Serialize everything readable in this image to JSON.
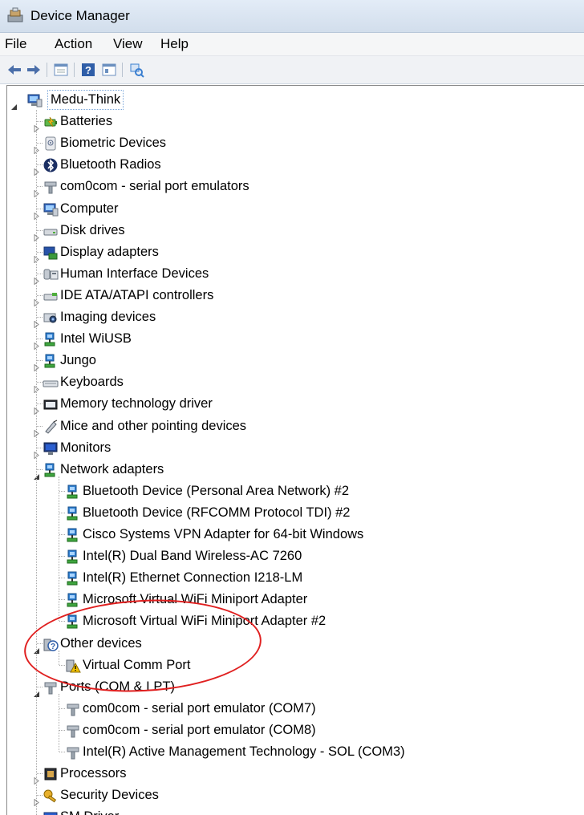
{
  "window": {
    "title": "Device Manager"
  },
  "menu": [
    "File",
    "Action",
    "View",
    "Help"
  ],
  "toolbar": [
    {
      "icon": "back-arrow-icon",
      "color": "#4a6ea9"
    },
    {
      "icon": "forward-arrow-icon",
      "color": "#4a6ea9"
    },
    {
      "icon": "properties-icon",
      "color": "#6a8fbf"
    },
    {
      "icon": "help-icon",
      "color": "#2f5ea8"
    },
    {
      "icon": "view-icon",
      "color": "#6a8fbf"
    },
    {
      "icon": "scan-hardware-icon",
      "color": "#3a7fd0"
    }
  ],
  "tree": [
    {
      "depth": 0,
      "state": "expanded",
      "icon": "computer-icon",
      "label": "Medu-Think",
      "selected": true
    },
    {
      "depth": 1,
      "state": "collapsed",
      "icon": "battery-icon",
      "label": "Batteries"
    },
    {
      "depth": 1,
      "state": "collapsed",
      "icon": "biometric-icon",
      "label": "Biometric Devices"
    },
    {
      "depth": 1,
      "state": "collapsed",
      "icon": "bluetooth-icon",
      "label": "Bluetooth Radios"
    },
    {
      "depth": 1,
      "state": "collapsed",
      "icon": "port-icon",
      "label": "com0com - serial port emulators"
    },
    {
      "depth": 1,
      "state": "collapsed",
      "icon": "computer-icon",
      "label": "Computer"
    },
    {
      "depth": 1,
      "state": "collapsed",
      "icon": "disk-icon",
      "label": "Disk drives"
    },
    {
      "depth": 1,
      "state": "collapsed",
      "icon": "display-icon",
      "label": "Display adapters"
    },
    {
      "depth": 1,
      "state": "collapsed",
      "icon": "hid-icon",
      "label": "Human Interface Devices"
    },
    {
      "depth": 1,
      "state": "collapsed",
      "icon": "ide-icon",
      "label": "IDE ATA/ATAPI controllers"
    },
    {
      "depth": 1,
      "state": "collapsed",
      "icon": "camera-icon",
      "label": "Imaging devices"
    },
    {
      "depth": 1,
      "state": "collapsed",
      "icon": "network-icon",
      "label": "Intel WiUSB"
    },
    {
      "depth": 1,
      "state": "collapsed",
      "icon": "network-icon",
      "label": "Jungo"
    },
    {
      "depth": 1,
      "state": "collapsed",
      "icon": "keyboard-icon",
      "label": "Keyboards"
    },
    {
      "depth": 1,
      "state": "collapsed",
      "icon": "memory-icon",
      "label": "Memory technology driver"
    },
    {
      "depth": 1,
      "state": "collapsed",
      "icon": "mouse-icon",
      "label": "Mice and other pointing devices"
    },
    {
      "depth": 1,
      "state": "collapsed",
      "icon": "monitor-icon",
      "label": "Monitors"
    },
    {
      "depth": 1,
      "state": "expanded",
      "icon": "network-icon",
      "label": "Network adapters"
    },
    {
      "depth": 2,
      "state": "leaf",
      "icon": "network-icon",
      "label": "Bluetooth Device (Personal Area Network) #2"
    },
    {
      "depth": 2,
      "state": "leaf",
      "icon": "network-icon",
      "label": "Bluetooth Device (RFCOMM Protocol TDI) #2"
    },
    {
      "depth": 2,
      "state": "leaf",
      "icon": "network-icon",
      "label": "Cisco Systems VPN Adapter for 64-bit Windows"
    },
    {
      "depth": 2,
      "state": "leaf",
      "icon": "network-icon",
      "label": "Intel(R) Dual Band Wireless-AC 7260"
    },
    {
      "depth": 2,
      "state": "leaf",
      "icon": "network-icon",
      "label": "Intel(R) Ethernet Connection I218-LM"
    },
    {
      "depth": 2,
      "state": "leaf",
      "icon": "network-icon",
      "label": "Microsoft Virtual WiFi Miniport Adapter"
    },
    {
      "depth": 2,
      "state": "leaf",
      "icon": "network-icon",
      "label": "Microsoft Virtual WiFi Miniport Adapter #2"
    },
    {
      "depth": 1,
      "state": "expanded",
      "icon": "unknown-device-icon",
      "label": "Other devices"
    },
    {
      "depth": 2,
      "state": "leaf",
      "icon": "warning-device-icon",
      "label": "Virtual Comm Port"
    },
    {
      "depth": 1,
      "state": "expanded",
      "icon": "port-icon",
      "label": "Ports (COM & LPT)"
    },
    {
      "depth": 2,
      "state": "leaf",
      "icon": "port-icon",
      "label": "com0com - serial port emulator (COM7)"
    },
    {
      "depth": 2,
      "state": "leaf",
      "icon": "port-icon",
      "label": "com0com - serial port emulator (COM8)"
    },
    {
      "depth": 2,
      "state": "leaf",
      "icon": "port-icon",
      "label": "Intel(R) Active Management Technology - SOL (COM3)"
    },
    {
      "depth": 1,
      "state": "collapsed",
      "icon": "processor-icon",
      "label": "Processors"
    },
    {
      "depth": 1,
      "state": "collapsed",
      "icon": "security-key-icon",
      "label": "Security Devices"
    },
    {
      "depth": 1,
      "state": "collapsed",
      "icon": "driver-icon",
      "label": "SM Driver"
    }
  ],
  "annotation": {
    "shape": "ellipse",
    "color": "#e02020"
  }
}
